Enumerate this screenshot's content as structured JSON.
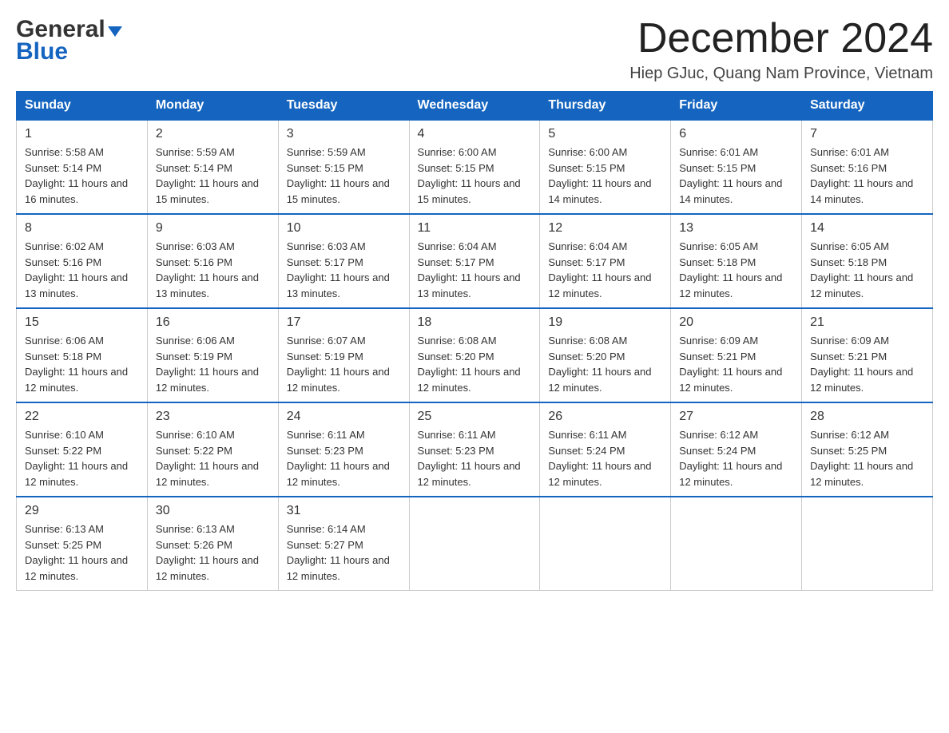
{
  "logo": {
    "general": "General",
    "blue": "Blue"
  },
  "title": {
    "month": "December 2024",
    "location": "Hiep GJuc, Quang Nam Province, Vietnam"
  },
  "days_of_week": [
    "Sunday",
    "Monday",
    "Tuesday",
    "Wednesday",
    "Thursday",
    "Friday",
    "Saturday"
  ],
  "weeks": [
    [
      {
        "day": "1",
        "sunrise": "5:58 AM",
        "sunset": "5:14 PM",
        "daylight": "11 hours and 16 minutes."
      },
      {
        "day": "2",
        "sunrise": "5:59 AM",
        "sunset": "5:14 PM",
        "daylight": "11 hours and 15 minutes."
      },
      {
        "day": "3",
        "sunrise": "5:59 AM",
        "sunset": "5:15 PM",
        "daylight": "11 hours and 15 minutes."
      },
      {
        "day": "4",
        "sunrise": "6:00 AM",
        "sunset": "5:15 PM",
        "daylight": "11 hours and 15 minutes."
      },
      {
        "day": "5",
        "sunrise": "6:00 AM",
        "sunset": "5:15 PM",
        "daylight": "11 hours and 14 minutes."
      },
      {
        "day": "6",
        "sunrise": "6:01 AM",
        "sunset": "5:15 PM",
        "daylight": "11 hours and 14 minutes."
      },
      {
        "day": "7",
        "sunrise": "6:01 AM",
        "sunset": "5:16 PM",
        "daylight": "11 hours and 14 minutes."
      }
    ],
    [
      {
        "day": "8",
        "sunrise": "6:02 AM",
        "sunset": "5:16 PM",
        "daylight": "11 hours and 13 minutes."
      },
      {
        "day": "9",
        "sunrise": "6:03 AM",
        "sunset": "5:16 PM",
        "daylight": "11 hours and 13 minutes."
      },
      {
        "day": "10",
        "sunrise": "6:03 AM",
        "sunset": "5:17 PM",
        "daylight": "11 hours and 13 minutes."
      },
      {
        "day": "11",
        "sunrise": "6:04 AM",
        "sunset": "5:17 PM",
        "daylight": "11 hours and 13 minutes."
      },
      {
        "day": "12",
        "sunrise": "6:04 AM",
        "sunset": "5:17 PM",
        "daylight": "11 hours and 12 minutes."
      },
      {
        "day": "13",
        "sunrise": "6:05 AM",
        "sunset": "5:18 PM",
        "daylight": "11 hours and 12 minutes."
      },
      {
        "day": "14",
        "sunrise": "6:05 AM",
        "sunset": "5:18 PM",
        "daylight": "11 hours and 12 minutes."
      }
    ],
    [
      {
        "day": "15",
        "sunrise": "6:06 AM",
        "sunset": "5:18 PM",
        "daylight": "11 hours and 12 minutes."
      },
      {
        "day": "16",
        "sunrise": "6:06 AM",
        "sunset": "5:19 PM",
        "daylight": "11 hours and 12 minutes."
      },
      {
        "day": "17",
        "sunrise": "6:07 AM",
        "sunset": "5:19 PM",
        "daylight": "11 hours and 12 minutes."
      },
      {
        "day": "18",
        "sunrise": "6:08 AM",
        "sunset": "5:20 PM",
        "daylight": "11 hours and 12 minutes."
      },
      {
        "day": "19",
        "sunrise": "6:08 AM",
        "sunset": "5:20 PM",
        "daylight": "11 hours and 12 minutes."
      },
      {
        "day": "20",
        "sunrise": "6:09 AM",
        "sunset": "5:21 PM",
        "daylight": "11 hours and 12 minutes."
      },
      {
        "day": "21",
        "sunrise": "6:09 AM",
        "sunset": "5:21 PM",
        "daylight": "11 hours and 12 minutes."
      }
    ],
    [
      {
        "day": "22",
        "sunrise": "6:10 AM",
        "sunset": "5:22 PM",
        "daylight": "11 hours and 12 minutes."
      },
      {
        "day": "23",
        "sunrise": "6:10 AM",
        "sunset": "5:22 PM",
        "daylight": "11 hours and 12 minutes."
      },
      {
        "day": "24",
        "sunrise": "6:11 AM",
        "sunset": "5:23 PM",
        "daylight": "11 hours and 12 minutes."
      },
      {
        "day": "25",
        "sunrise": "6:11 AM",
        "sunset": "5:23 PM",
        "daylight": "11 hours and 12 minutes."
      },
      {
        "day": "26",
        "sunrise": "6:11 AM",
        "sunset": "5:24 PM",
        "daylight": "11 hours and 12 minutes."
      },
      {
        "day": "27",
        "sunrise": "6:12 AM",
        "sunset": "5:24 PM",
        "daylight": "11 hours and 12 minutes."
      },
      {
        "day": "28",
        "sunrise": "6:12 AM",
        "sunset": "5:25 PM",
        "daylight": "11 hours and 12 minutes."
      }
    ],
    [
      {
        "day": "29",
        "sunrise": "6:13 AM",
        "sunset": "5:25 PM",
        "daylight": "11 hours and 12 minutes."
      },
      {
        "day": "30",
        "sunrise": "6:13 AM",
        "sunset": "5:26 PM",
        "daylight": "11 hours and 12 minutes."
      },
      {
        "day": "31",
        "sunrise": "6:14 AM",
        "sunset": "5:27 PM",
        "daylight": "11 hours and 12 minutes."
      },
      null,
      null,
      null,
      null
    ]
  ]
}
